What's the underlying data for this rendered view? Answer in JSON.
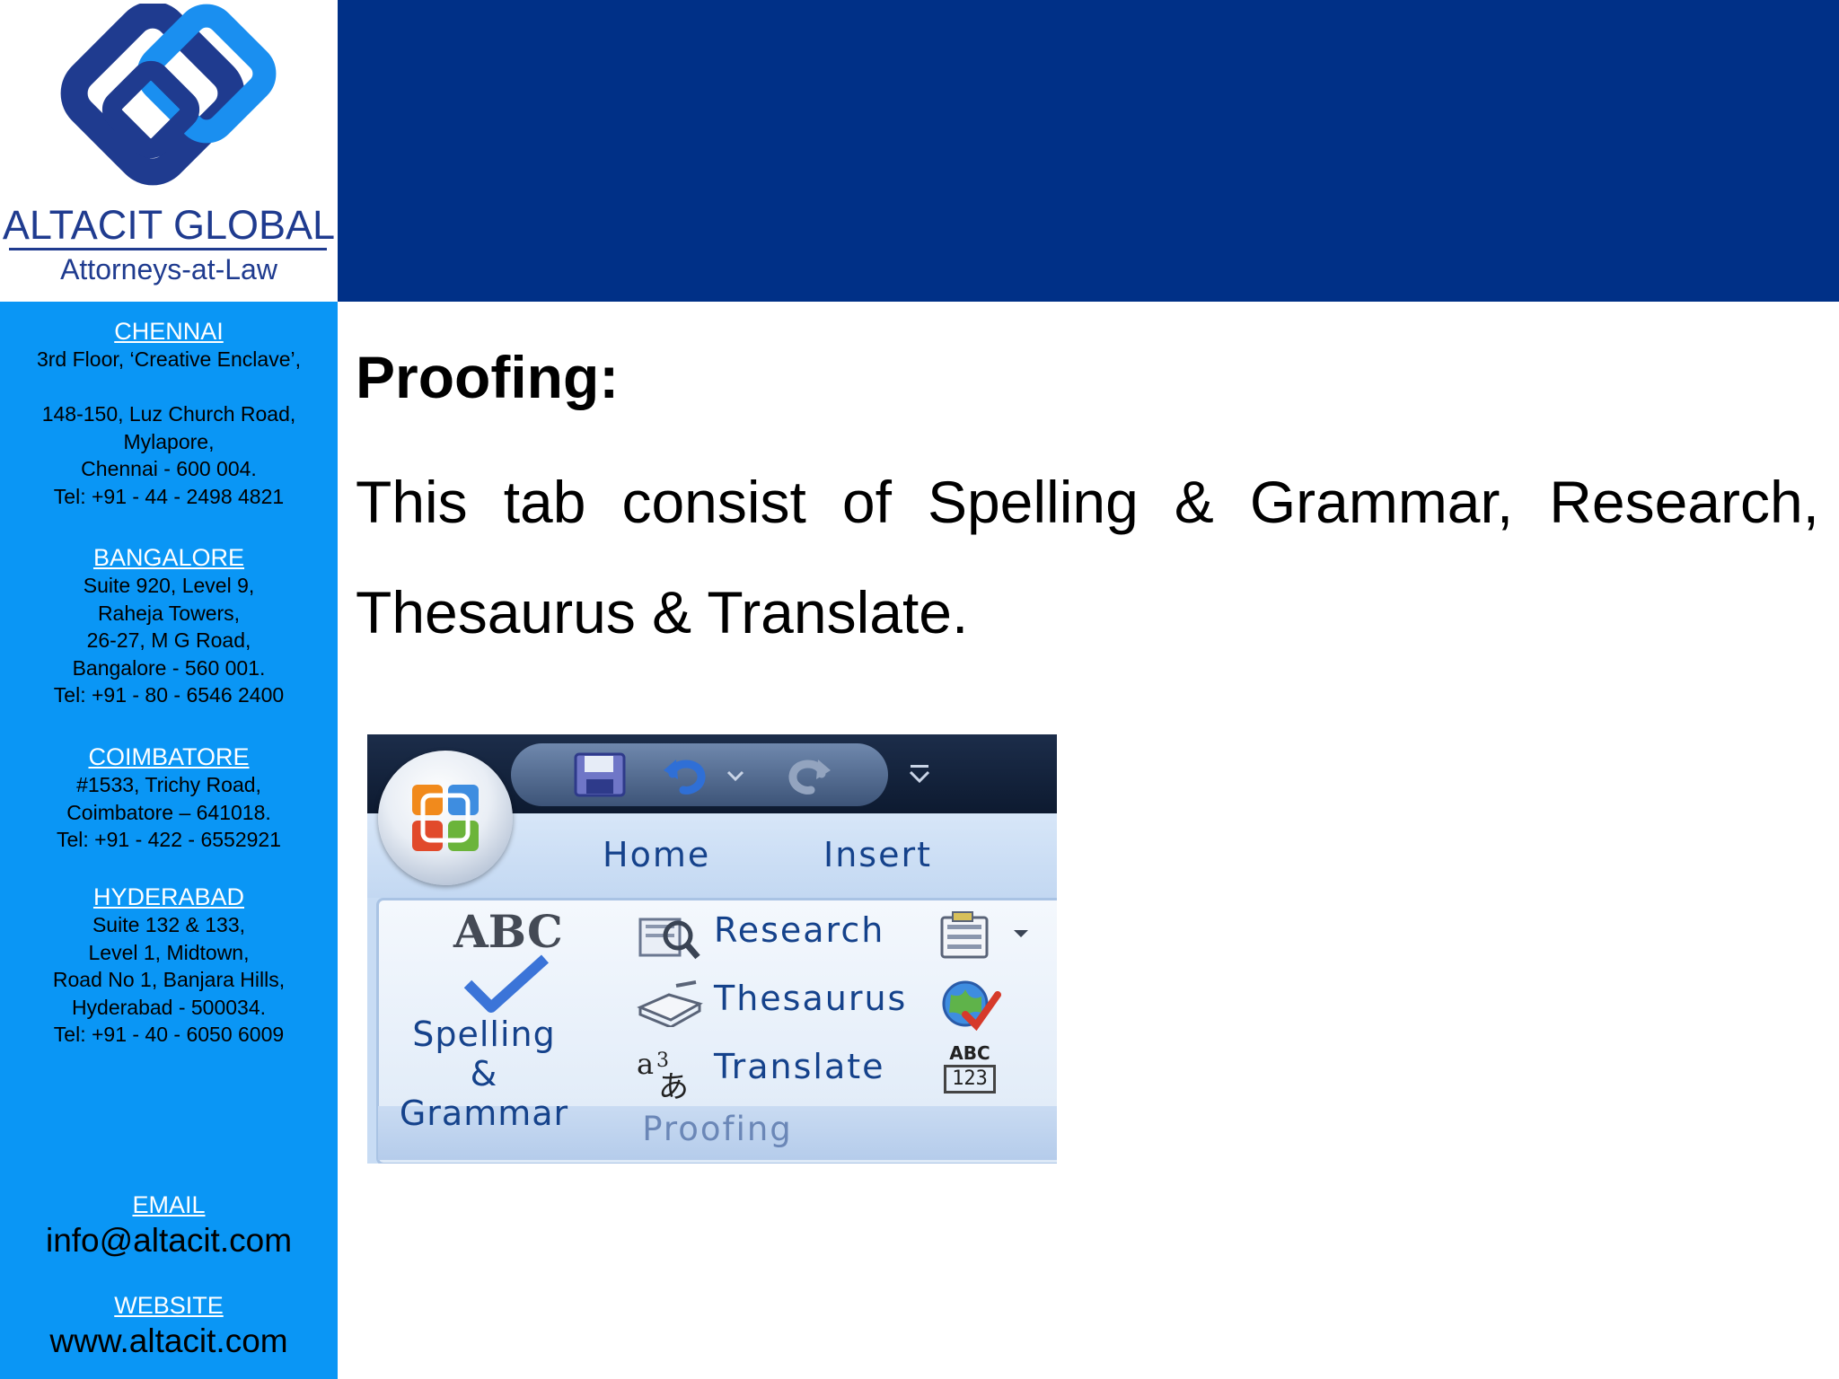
{
  "logo": {
    "name": "ALTACIT GLOBAL",
    "tagline": "Attorneys-at-Law"
  },
  "offices": [
    {
      "city": "CHENNAI",
      "lines": [
        "3rd Floor, ‘Creative Enclave’,",
        "",
        "148-150, Luz Church Road,",
        "Mylapore,",
        "Chennai - 600 004.",
        "Tel: +91 - 44 - 2498 4821"
      ]
    },
    {
      "city": "BANGALORE ",
      "lines": [
        "Suite 920, Level 9,",
        "Raheja Towers,",
        "26-27, M G Road,",
        "Bangalore - 560 001.",
        "Tel: +91 - 80 - 6546 2400"
      ]
    },
    {
      "city": "COIMBATORE",
      "lines": [
        "#1533, Trichy Road,",
        "Coimbatore – 641018.",
        "Tel: +91 - 422 - 6552921"
      ]
    },
    {
      "city": "HYDERABAD",
      "lines": [
        "Suite 132 & 133,",
        "Level 1, Midtown,",
        "Road No 1, Banjara Hills,",
        "Hyderabad - 500034.",
        "Tel: +91 - 40 - 6050 6009"
      ]
    }
  ],
  "contact": {
    "email_label": "EMAIL",
    "email": "info@altacit.com",
    "website_label": "WEBSITE",
    "website": "www.altacit.com"
  },
  "slide": {
    "heading": "Proofing:",
    "body_line1": "This tab consist of Spelling & Grammar, Research,",
    "body_line2": "Thesaurus & Translate."
  },
  "ribbon": {
    "tabs": [
      "Home",
      "Insert"
    ],
    "abc": "ABC",
    "spelling_line1": "Spelling &",
    "spelling_line2": "Grammar",
    "research": "Research",
    "thesaurus": "Thesaurus",
    "translate": "Translate",
    "group_name": "Proofing",
    "word_count_icon_text_top": "ABC",
    "word_count_icon_text_bottom": "123"
  },
  "colors": {
    "banner": "#003087",
    "sidebar": "#0a96f5",
    "logo_dark": "#1f3b8f",
    "logo_light": "#1a8ff0",
    "ribbon_text": "#15428b"
  }
}
